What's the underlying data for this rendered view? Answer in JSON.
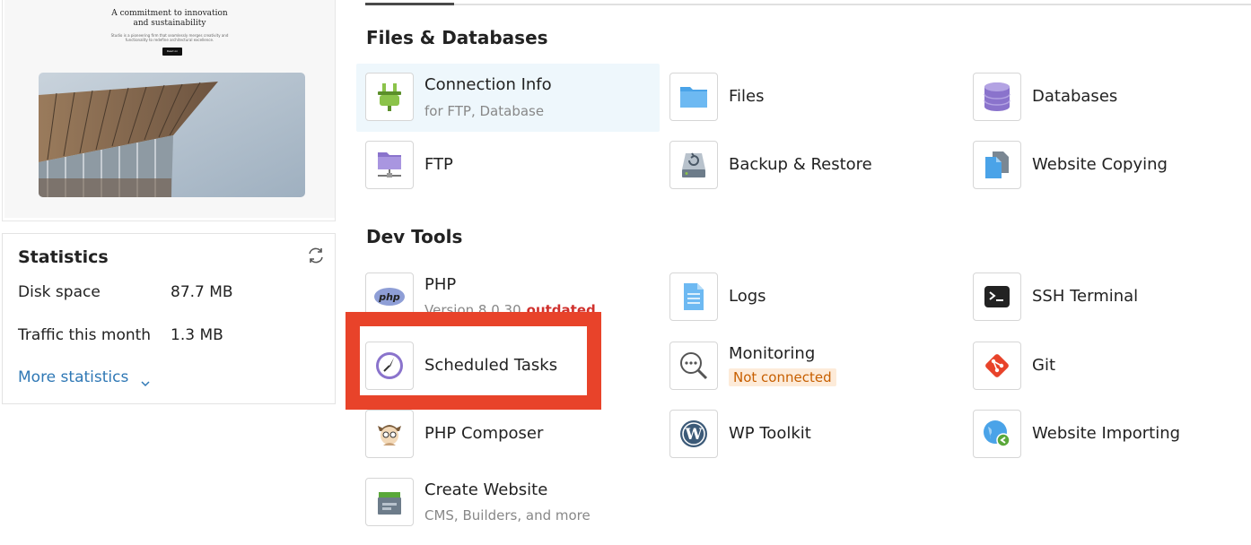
{
  "preview": {
    "hero_title_line1": "A commitment to innovation",
    "hero_title_line2": "and sustainability",
    "hero_sub_line1": "Studio is a pioneering firm that seamlessly merges creativity and",
    "hero_sub_line2": "functionality to redefine architectural excellence.",
    "hero_button": "Read on"
  },
  "statistics": {
    "title": "Statistics",
    "refresh_icon": "refresh-icon",
    "rows": [
      {
        "label": "Disk space",
        "value": "87.7 MB"
      },
      {
        "label": "Traffic this month",
        "value": "1.3 MB"
      }
    ],
    "more_link": "More statistics"
  },
  "sections": {
    "files_title": "Files & Databases",
    "dev_title": "Dev Tools"
  },
  "tools": {
    "connection_info": {
      "name": "Connection Info",
      "sub": "for FTP, Database",
      "icon": "plug-icon"
    },
    "files": {
      "name": "Files",
      "icon": "folder-icon"
    },
    "databases": {
      "name": "Databases",
      "icon": "database-icon"
    },
    "ftp": {
      "name": "FTP",
      "icon": "ftp-folder-icon"
    },
    "backup": {
      "name": "Backup & Restore",
      "icon": "backup-drive-icon"
    },
    "website_copying": {
      "name": "Website Copying",
      "icon": "copy-pages-icon"
    },
    "php": {
      "name": "PHP",
      "sub": "Version 8.0.30",
      "badge": "outdated",
      "icon": "php-icon"
    },
    "logs": {
      "name": "Logs",
      "icon": "log-document-icon"
    },
    "ssh": {
      "name": "SSH Terminal",
      "icon": "terminal-icon"
    },
    "scheduled": {
      "name": "Scheduled Tasks",
      "icon": "clock-icon"
    },
    "monitoring": {
      "name": "Monitoring",
      "badge": "Not connected",
      "icon": "magnifier-icon"
    },
    "git": {
      "name": "Git",
      "icon": "git-icon"
    },
    "composer": {
      "name": "PHP Composer",
      "icon": "composer-icon"
    },
    "wp_toolkit": {
      "name": "WP Toolkit",
      "icon": "wordpress-icon"
    },
    "website_importing": {
      "name": "Website Importing",
      "icon": "globe-import-icon"
    },
    "create_website": {
      "name": "Create Website",
      "sub": "CMS, Builders, and more",
      "icon": "website-box-icon"
    }
  },
  "colors": {
    "accent_link": "#2f78b5",
    "highlight_box": "#e8432a",
    "outdated": "#d0312d",
    "not_connected_bg": "#fdebd9",
    "not_connected_text": "#c75f00"
  }
}
